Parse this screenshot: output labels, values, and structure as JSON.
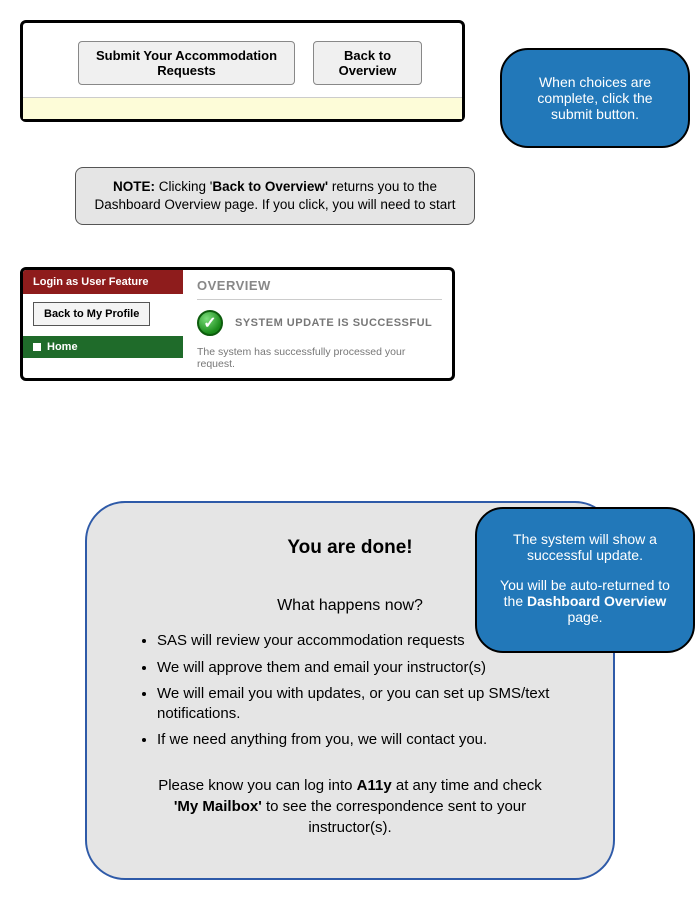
{
  "section1": {
    "submit_button": "Submit Your Accommodation Requests",
    "back_button": "Back to Overview"
  },
  "callout1": {
    "text": "When choices are complete, click the submit button."
  },
  "note": {
    "prefix": "NOTE:",
    "mid1": " Clicking '",
    "bold1": "Back to Overview'",
    "mid2": " returns you to the Dashboard Overview page. If you click, you will need to start"
  },
  "overview": {
    "left": {
      "login_feature": "Login as User Feature",
      "back_profile": "Back to My Profile",
      "home": "Home"
    },
    "right": {
      "title": "OVERVIEW",
      "status": "SYSTEM UPDATE IS SUCCESSFUL",
      "sub": "The system has successfully processed your request."
    }
  },
  "callout2": {
    "line1": "The system will show a successful update.",
    "line2_pre": "You will be auto-returned to the ",
    "line2_bold": "Dashboard Overview",
    "line2_post": " page."
  },
  "done": {
    "heading": "You are done!",
    "sub": "What happens now?",
    "items": [
      "SAS will review your accommodation requests",
      "We will approve them and email your instructor(s)",
      "We will email you with updates, or you can set up SMS/text notifications.",
      "If we need anything from you, we will contact you."
    ],
    "closing_pre": "Please know you can log into ",
    "closing_b1": "A11y",
    "closing_mid": " at any time and check ",
    "closing_b2": "'My Mailbox'",
    "closing_post": " to see the correspondence sent to your instructor(s)."
  }
}
